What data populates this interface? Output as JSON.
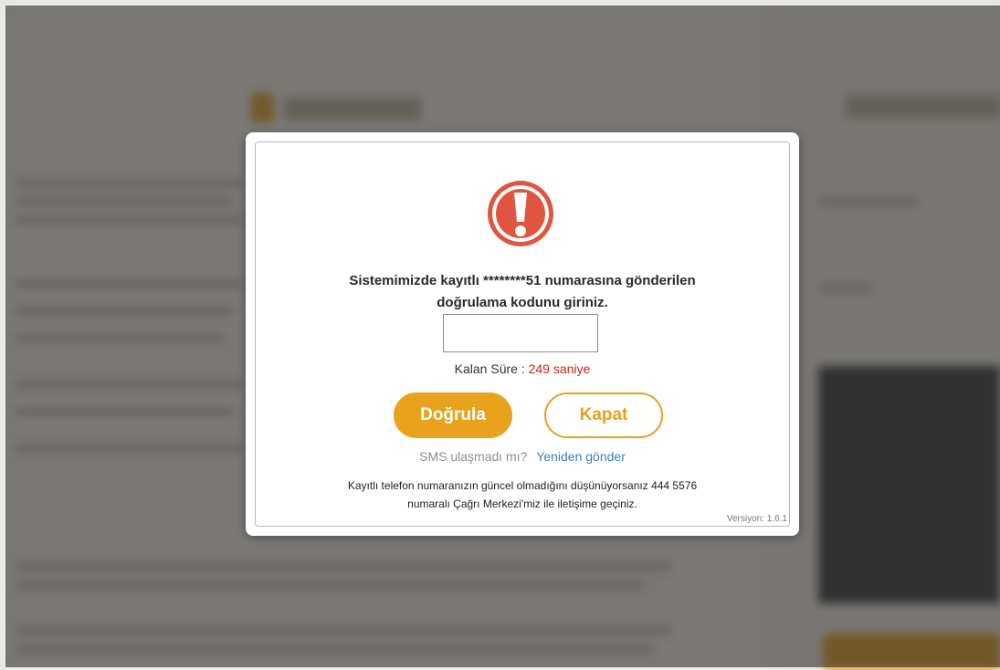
{
  "dialog": {
    "icon": "exclamation-circle-icon",
    "message_line1": "Sistemimizde kayıtlı ********51 numarasına gönderilen",
    "message_line2": "doğrulama kodunu giriniz.",
    "code_input_value": "",
    "timer_label": "Kalan Süre :",
    "timer_value": "249 saniye",
    "verify_button": "Doğrula",
    "close_button": "Kapat",
    "sms_question": "SMS ulaşmadı mı?",
    "resend_link": "Yeniden gönder",
    "info_line1": "Kayıtlı telefon numaranızın güncel olmadığını düşünüyorsanız 444 5576",
    "info_line2": "numaralı Çağrı Merkezi'miz ile iletişime geçiniz.",
    "version": "Versiyon: 1.6.1"
  },
  "colors": {
    "accent": "#e8a21b",
    "timer": "#d0201f",
    "link": "#3f7ebf",
    "warning_icon": "#e0553f"
  }
}
